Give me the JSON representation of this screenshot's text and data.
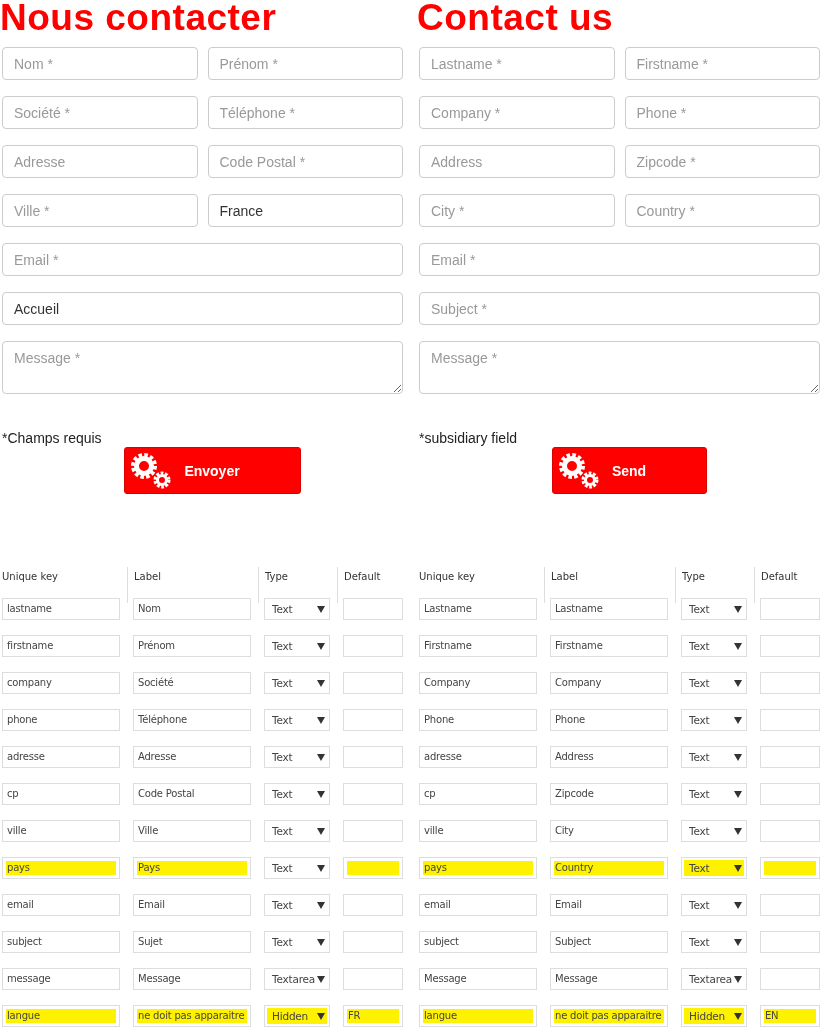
{
  "forms": [
    {
      "title": "Nous contacter",
      "fields": [
        {
          "kind": "half",
          "placeholder": "Nom *"
        },
        {
          "kind": "half",
          "placeholder": "Prénom *"
        },
        {
          "kind": "half",
          "placeholder": "Société *"
        },
        {
          "kind": "half",
          "placeholder": "Téléphone *"
        },
        {
          "kind": "half",
          "placeholder": "Adresse"
        },
        {
          "kind": "half",
          "placeholder": "Code Postal *"
        },
        {
          "kind": "half",
          "placeholder": "Ville *"
        },
        {
          "kind": "half",
          "value": "France"
        },
        {
          "kind": "full",
          "placeholder": "Email *"
        },
        {
          "kind": "full",
          "value": "Accueil"
        },
        {
          "kind": "textarea",
          "placeholder": "Message *"
        }
      ],
      "note": "*Champs requis",
      "button": "Envoyer",
      "table": {
        "columns": [
          "Unique key",
          "Label",
          "Type",
          "Default"
        ],
        "rows": [
          {
            "key": "lastname",
            "label": "Nom",
            "type": "Text",
            "highlighted": false,
            "type_highlighted": false
          },
          {
            "key": "firstname",
            "label": "Prénom",
            "type": "Text",
            "highlighted": false,
            "type_highlighted": false
          },
          {
            "key": "company",
            "label": "Société",
            "type": "Text",
            "highlighted": false,
            "type_highlighted": false
          },
          {
            "key": "phone",
            "label": "Téléphone",
            "type": "Text",
            "highlighted": false,
            "type_highlighted": false
          },
          {
            "key": "adresse",
            "label": "Adresse",
            "type": "Text",
            "highlighted": false,
            "type_highlighted": false
          },
          {
            "key": "cp",
            "label": "Code Postal",
            "type": "Text",
            "highlighted": false,
            "type_highlighted": false
          },
          {
            "key": "ville",
            "label": "Ville",
            "type": "Text",
            "highlighted": false,
            "type_highlighted": false
          },
          {
            "key": "pays",
            "label": "Pays",
            "type": "Text",
            "highlighted": true,
            "type_highlighted": false
          },
          {
            "key": "email",
            "label": "Email",
            "type": "Text",
            "highlighted": false,
            "type_highlighted": false
          },
          {
            "key": "subject",
            "label": "Sujet",
            "type": "Text",
            "highlighted": false,
            "type_highlighted": false
          },
          {
            "key": "message",
            "label": "Message",
            "type": "Textarea",
            "highlighted": false,
            "type_highlighted": false
          },
          {
            "key": "langue",
            "label": "ne doit pas apparaitre",
            "type": "Hidden",
            "default": "FR",
            "highlighted": true,
            "type_highlighted": true
          }
        ]
      }
    },
    {
      "title": "Contact us",
      "fields": [
        {
          "kind": "half",
          "placeholder": "Lastname *"
        },
        {
          "kind": "half",
          "placeholder": "Firstname *"
        },
        {
          "kind": "half",
          "placeholder": "Company *"
        },
        {
          "kind": "half",
          "placeholder": "Phone *"
        },
        {
          "kind": "half",
          "placeholder": "Address"
        },
        {
          "kind": "half",
          "placeholder": "Zipcode *"
        },
        {
          "kind": "half",
          "placeholder": "City *"
        },
        {
          "kind": "half",
          "placeholder": "Country *"
        },
        {
          "kind": "full",
          "placeholder": "Email *"
        },
        {
          "kind": "full",
          "placeholder": "Subject *"
        },
        {
          "kind": "textarea",
          "placeholder": "Message *"
        }
      ],
      "note": "*subsidiary field",
      "button": "Send",
      "table": {
        "columns": [
          "Unique key",
          "Label",
          "Type",
          "Default"
        ],
        "rows": [
          {
            "key": "Lastname",
            "label": "Lastname",
            "type": "Text",
            "highlighted": false,
            "type_highlighted": false
          },
          {
            "key": "Firstname",
            "label": "Firstname",
            "type": "Text",
            "highlighted": false,
            "type_highlighted": false
          },
          {
            "key": "Company",
            "label": "Company",
            "type": "Text",
            "highlighted": false,
            "type_highlighted": false
          },
          {
            "key": "Phone",
            "label": "Phone",
            "type": "Text",
            "highlighted": false,
            "type_highlighted": false
          },
          {
            "key": "adresse",
            "label": "Address",
            "type": "Text",
            "highlighted": false,
            "type_highlighted": false
          },
          {
            "key": "cp",
            "label": "Zipcode",
            "type": "Text",
            "highlighted": false,
            "type_highlighted": false
          },
          {
            "key": "ville",
            "label": "City",
            "type": "Text",
            "highlighted": false,
            "type_highlighted": false
          },
          {
            "key": "pays",
            "label": "Country",
            "type": "Text",
            "highlighted": true,
            "type_highlighted": true
          },
          {
            "key": "email",
            "label": "Email",
            "type": "Text",
            "highlighted": false,
            "type_highlighted": false
          },
          {
            "key": "subject",
            "label": "Subject",
            "type": "Text",
            "highlighted": false,
            "type_highlighted": false
          },
          {
            "key": "Message",
            "label": "Message",
            "type": "Textarea",
            "highlighted": false,
            "type_highlighted": false
          },
          {
            "key": "langue",
            "label": "ne doit pas apparaitre",
            "type": "Hidden",
            "default": "EN",
            "highlighted": true,
            "type_highlighted": true
          }
        ]
      }
    }
  ]
}
